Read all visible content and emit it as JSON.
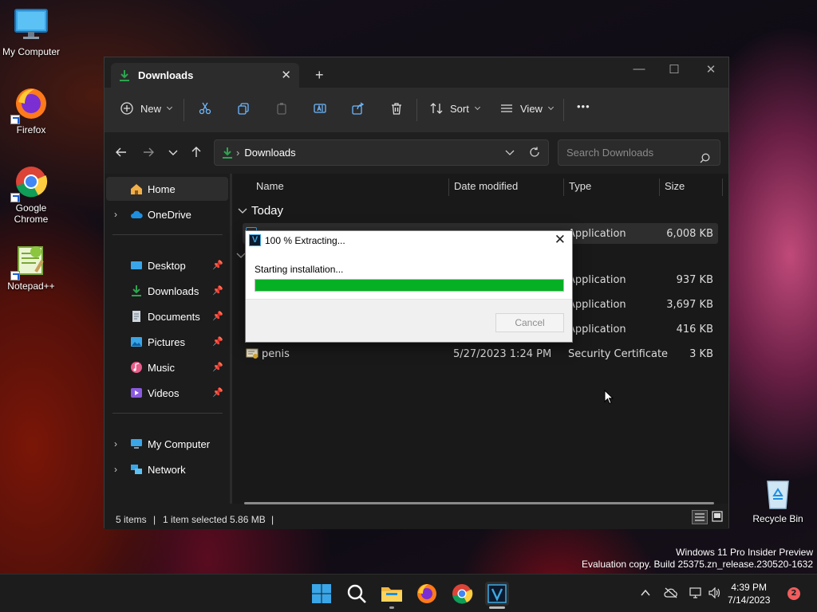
{
  "desktop": {
    "icons": [
      {
        "label": "My Computer",
        "icon": "monitor-icon"
      },
      {
        "label": "Firefox",
        "icon": "firefox-icon"
      },
      {
        "label": "Google Chrome",
        "icon": "chrome-icon"
      },
      {
        "label": "Notepad++",
        "icon": "notepadpp-icon"
      },
      {
        "label": "Recycle Bin",
        "icon": "recycle-bin-icon"
      }
    ],
    "watermark_line1": "Windows 11 Pro Insider Preview",
    "watermark_line2": "Evaluation copy. Build 25375.zn_release.230520-1632"
  },
  "explorer": {
    "tab_title": "Downloads",
    "tab_close": "✕",
    "new_tab": "+",
    "window_controls": {
      "minimize": "—",
      "maximize": "☐",
      "close": "✕"
    },
    "toolbar": {
      "new_label": "New",
      "sort_label": "Sort",
      "view_label": "View",
      "more_label": "•••"
    },
    "address": {
      "crumb": "Downloads",
      "search_placeholder": "Search Downloads"
    },
    "nav": {
      "home": "Home",
      "onedrive": "OneDrive",
      "desktop": "Desktop",
      "downloads": "Downloads",
      "documents": "Documents",
      "pictures": "Pictures",
      "music": "Music",
      "videos": "Videos",
      "my_computer": "My Computer",
      "network": "Network"
    },
    "columns": {
      "name": "Name",
      "date": "Date modified",
      "type": "Type",
      "size": "Size"
    },
    "group_today": "Today",
    "rows": [
      {
        "name": "",
        "date": "",
        "type": "Application",
        "size": "6,008 KB"
      },
      {
        "name": "",
        "date": "",
        "type": "Application",
        "size": "937 KB"
      },
      {
        "name": "",
        "date": "",
        "type": "Application",
        "size": "3,697 KB"
      },
      {
        "name": "",
        "date": "",
        "type": "Application",
        "size": "416 KB"
      },
      {
        "name": "penis",
        "date": "5/27/2023 1:24 PM",
        "type": "Security Certificate",
        "size": "3 KB"
      }
    ],
    "status": {
      "items": "5 items",
      "selected": "1 item selected  5.86 MB",
      "sep": "|"
    }
  },
  "dialog": {
    "title": "100 % Extracting...",
    "logo": "V",
    "close": "✕",
    "status": "Starting installation...",
    "progress": 1.0,
    "cancel_label": "Cancel"
  },
  "taskbar": {
    "time": "4:39 PM",
    "date": "7/14/2023",
    "notifications": "2"
  },
  "colors": {
    "progress_fill": "#06b025",
    "accent": "#0078d4",
    "downloads_green": "#2ea44f"
  }
}
